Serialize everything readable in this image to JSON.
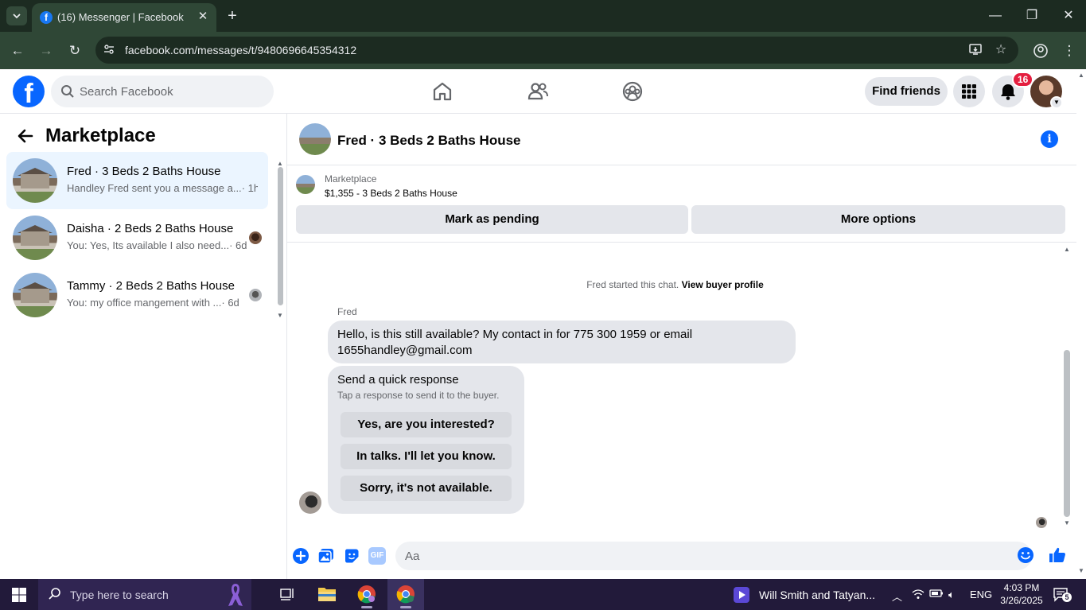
{
  "browser": {
    "tab_title": "(16) Messenger | Facebook",
    "url": "facebook.com/messages/t/9480696645354312"
  },
  "fb": {
    "search_placeholder": "Search Facebook",
    "find_friends": "Find friends",
    "notification_count": "16"
  },
  "sidebar": {
    "title": "Marketplace",
    "conversations": [
      {
        "name": "Fred · 3 Beds 2 Baths House",
        "preview": "Handley Fred sent you a message a...",
        "time": "· 1h",
        "active": true
      },
      {
        "name": "Daisha · 2 Beds 2 Baths House",
        "preview": "You: Yes, Its available I also need...",
        "time": "· 6d",
        "active": false
      },
      {
        "name": "Tammy · 2 Beds 2 Baths House",
        "preview": "You: my office mangement with ...",
        "time": "· 6d",
        "active": false
      }
    ]
  },
  "chat": {
    "title": "Fred · 3 Beds 2 Baths House",
    "listing_label": "Marketplace",
    "listing_price": "$1,355 - 3 Beds 2 Baths House",
    "mark_pending": "Mark as pending",
    "more_options": "More options",
    "system_text": "Fred started this chat.",
    "system_link": "View buyer profile",
    "sender": "Fred",
    "message": "Hello, is this still available? My contact in for 775 300 1959 or email 1655handley@gmail.com",
    "quick_title": "Send a quick response",
    "quick_sub": "Tap a response to send it to the buyer.",
    "quick_responses": [
      "Yes, are you interested?",
      "In talks. I'll let you know.",
      "Sorry, it's not available."
    ],
    "composer_placeholder": "Aa",
    "gif_label": "GIF"
  },
  "taskbar": {
    "search_placeholder": "Type here to search",
    "media_title": "Will Smith and Tatyan...",
    "language": "ENG",
    "time": "4:03 PM",
    "date": "3/26/2025",
    "notif_count": "5"
  }
}
